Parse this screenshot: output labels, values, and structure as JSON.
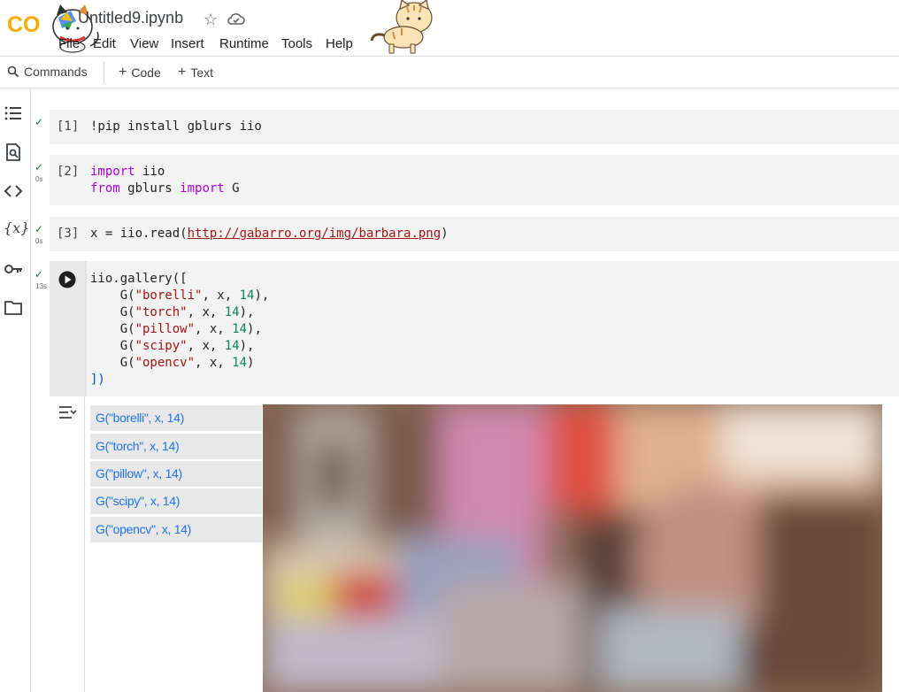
{
  "header": {
    "logo_text": "CO",
    "notebook_title": "Untitled9.ipynb",
    "menu": [
      "File",
      "Edit",
      "View",
      "Insert",
      "Runtime",
      "Tools",
      "Help"
    ]
  },
  "toolbar": {
    "commands_label": "Commands",
    "add_code_label": "Code",
    "add_text_label": "Text"
  },
  "sidebar": {
    "icons": [
      "table-of-contents-icon",
      "find-icon",
      "code-snippets-icon",
      "variables-icon",
      "secrets-key-icon",
      "files-folder-icon"
    ]
  },
  "cells": [
    {
      "prompt": "[1]",
      "time": ""
    },
    {
      "prompt": "[2]",
      "time": "0s"
    },
    {
      "prompt": "[3]",
      "time": "0s"
    },
    {
      "prompt": "",
      "time": "13s"
    }
  ],
  "code": {
    "c1": {
      "bang": "!pip install gblurs iio"
    },
    "c2": {
      "l1_kw": "import",
      "l1_rest": " iio",
      "l2_kw1": "from",
      "l2_mid": " gblurs ",
      "l2_kw2": "import",
      "l2_rest": " G"
    },
    "c3": {
      "pre": "x = iio.read(",
      "url": "http://gabarro.org/img/barbara.png",
      "post": ")"
    },
    "c4": {
      "head": "iio.gallery([",
      "lines": [
        {
          "fn": "G(",
          "str": "\"borelli\"",
          "mid": ", x, ",
          "num": "14",
          "end": "),"
        },
        {
          "fn": "G(",
          "str": "\"torch\"",
          "mid": ", x, ",
          "num": "14",
          "end": "),"
        },
        {
          "fn": "G(",
          "str": "\"pillow\"",
          "mid": ", x, ",
          "num": "14",
          "end": "),"
        },
        {
          "fn": "G(",
          "str": "\"scipy\"",
          "mid": ", x, ",
          "num": "14",
          "end": "),"
        },
        {
          "fn": "G(",
          "str": "\"opencv\"",
          "mid": ", x, ",
          "num": "14",
          "end": ")"
        }
      ],
      "tail": "])"
    }
  },
  "gallery": {
    "items": [
      "G(\"borelli\", x, 14)",
      "G(\"torch\", x, 14)",
      "G(\"pillow\", x, 14)",
      "G(\"scipy\", x, 14)",
      "G(\"opencv\", x, 14)"
    ]
  }
}
